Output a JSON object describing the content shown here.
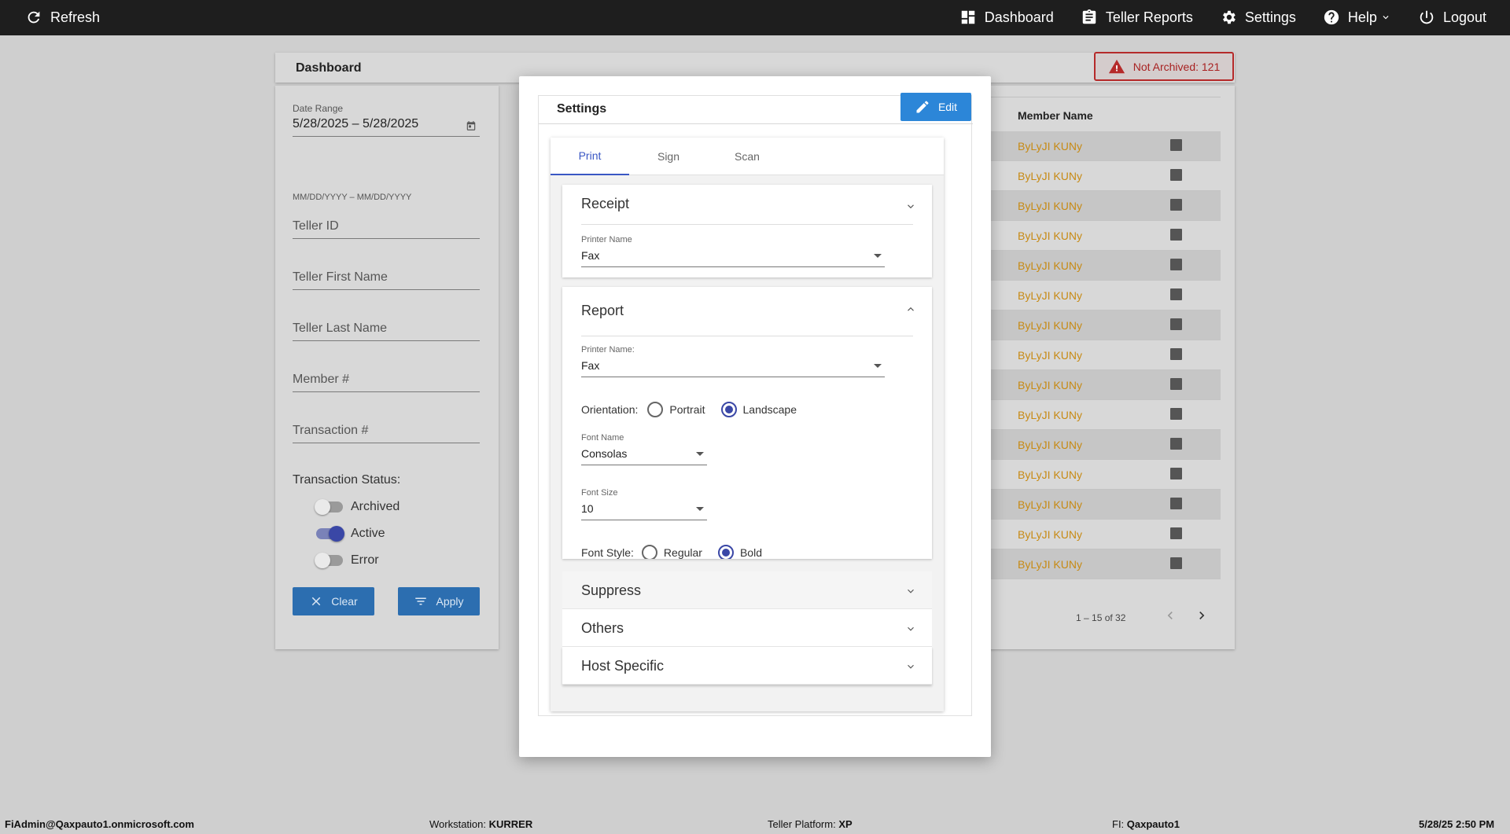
{
  "topbar": {
    "refresh": "Refresh",
    "nav": [
      {
        "label": "Dashboard",
        "icon": "dashboard-icon"
      },
      {
        "label": "Teller Reports",
        "icon": "clipboard-icon"
      },
      {
        "label": "Settings",
        "icon": "gear-icon"
      },
      {
        "label": "Help",
        "icon": "help-icon"
      },
      {
        "label": "Logout",
        "icon": "power-icon"
      }
    ]
  },
  "dashboard": {
    "title": "Dashboard",
    "not_archived": "Not Archived: 121"
  },
  "filters": {
    "date_range_label": "Date Range",
    "date_range_value": "5/28/2025 – 5/28/2025",
    "date_hint": "MM/DD/YYYY – MM/DD/YYYY",
    "teller_id": "Teller ID",
    "teller_first_name": "Teller First Name",
    "teller_last_name": "Teller Last Name",
    "member_no": "Member #",
    "transaction_no": "Transaction #",
    "status_label": "Transaction Status:",
    "toggles": [
      {
        "label": "Archived",
        "on": false
      },
      {
        "label": "Active",
        "on": true
      },
      {
        "label": "Error",
        "on": false
      }
    ],
    "clear": "Clear",
    "apply": "Apply"
  },
  "table": {
    "header": "Member Name",
    "rows": [
      "ByLyJI KUNy",
      "ByLyJI KUNy",
      "ByLyJI KUNy",
      "ByLyJI KUNy",
      "ByLyJI KUNy",
      "ByLyJI KUNy",
      "ByLyJI KUNy",
      "ByLyJI KUNy",
      "ByLyJI KUNy",
      "ByLyJI KUNy",
      "ByLyJI KUNy",
      "ByLyJI KUNy",
      "ByLyJI KUNy",
      "ByLyJI KUNy",
      "ByLyJI KUNy"
    ],
    "pager": "1 – 15 of 32"
  },
  "modal": {
    "title": "Settings",
    "edit": "Edit",
    "tabs": [
      "Print",
      "Sign",
      "Scan"
    ],
    "receipt": {
      "title": "Receipt",
      "printer_label": "Printer Name",
      "printer_value": "Fax"
    },
    "report": {
      "title": "Report",
      "printer_label": "Printer Name:",
      "printer_value": "Fax",
      "orientation_label": "Orientation:",
      "portrait": "Portrait",
      "landscape": "Landscape",
      "font_name_label": "Font Name",
      "font_name_value": "Consolas",
      "font_size_label": "Font Size",
      "font_size_value": "10",
      "font_style_label": "Font Style:",
      "regular": "Regular",
      "bold": "Bold"
    },
    "accordions": [
      "Suppress",
      "Others",
      "Host Specific"
    ]
  },
  "statusbar": {
    "user": "FiAdmin@Qaxpauto1.onmicrosoft.com",
    "workstation_label": "Workstation: ",
    "workstation": "KURRER",
    "platform_label": "Teller Platform: ",
    "platform": "XP",
    "fi_label": "FI: ",
    "fi": "Qaxpauto1",
    "datetime": "5/28/25 2:50 PM"
  },
  "colors": {
    "accent": "#3a57c4",
    "link": "#c78a14",
    "button": "#2c86d8",
    "alert": "#b52a2a"
  }
}
